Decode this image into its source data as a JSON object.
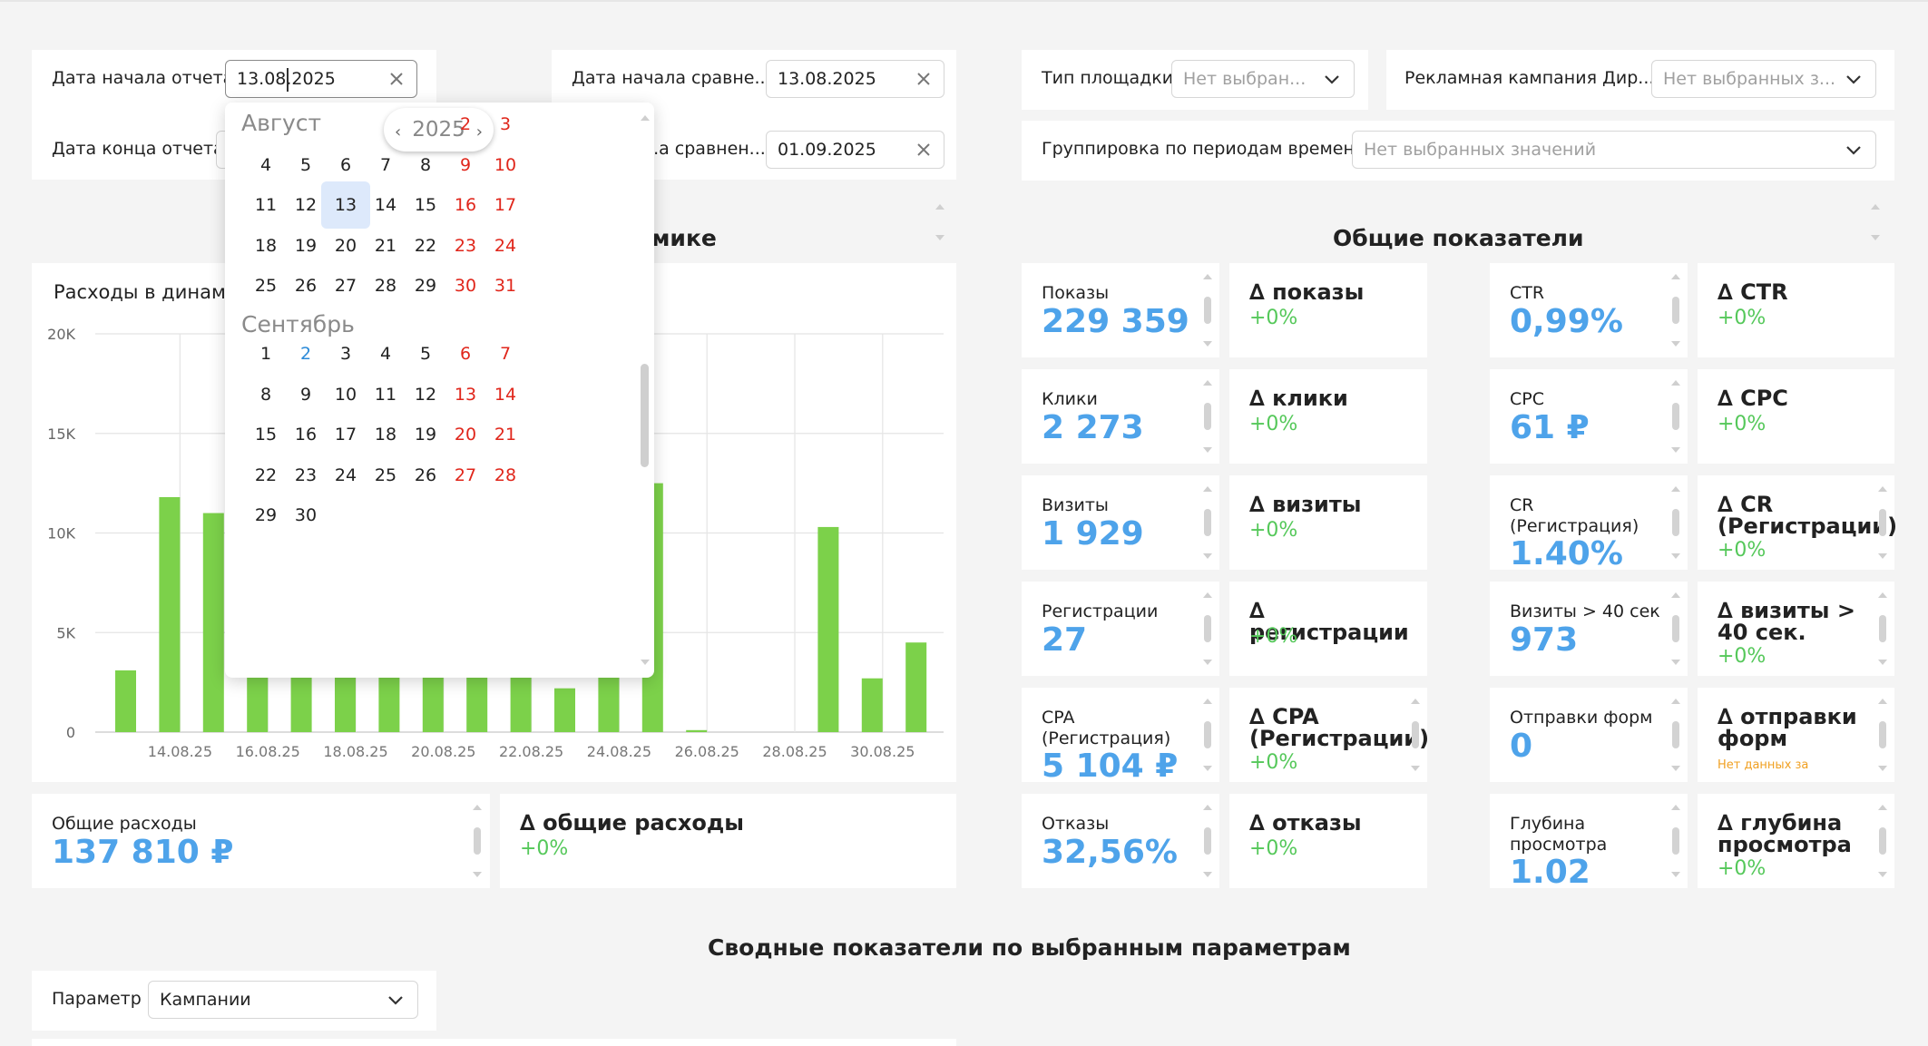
{
  "filters": {
    "report_start_label": "Дата начала отчета",
    "report_start_value": "13.08.2025",
    "report_end_label": "Дата конца отчета",
    "compare_start_label": "Дата начала сравне...",
    "compare_start_value": "13.08.2025",
    "compare_end_label": "...а сравнен...",
    "compare_end_value": "01.09.2025",
    "platform_label": "Тип площадки",
    "platform_placeholder": "Нет выбран...",
    "campaign_label": "Рекламная кампания Дир...",
    "campaign_placeholder": "Нет выбранных з...",
    "grouping_label": "Группировка по периодам времени",
    "grouping_placeholder": "Нет выбранных значений"
  },
  "calendar": {
    "year": "2025",
    "months": [
      {
        "name": "Август",
        "rows": [
          [
            {
              "d": "2",
              "we": true
            },
            {
              "d": "3",
              "we": true
            }
          ],
          [
            {
              "d": "4"
            },
            {
              "d": "5"
            },
            {
              "d": "6"
            },
            {
              "d": "7"
            },
            {
              "d": "8"
            },
            {
              "d": "9",
              "we": true
            },
            {
              "d": "10",
              "we": true
            }
          ],
          [
            {
              "d": "11"
            },
            {
              "d": "12"
            },
            {
              "d": "13",
              "sel": true
            },
            {
              "d": "14"
            },
            {
              "d": "15"
            },
            {
              "d": "16",
              "we": true
            },
            {
              "d": "17",
              "we": true
            }
          ],
          [
            {
              "d": "18"
            },
            {
              "d": "19"
            },
            {
              "d": "20"
            },
            {
              "d": "21"
            },
            {
              "d": "22"
            },
            {
              "d": "23",
              "we": true
            },
            {
              "d": "24",
              "we": true
            }
          ],
          [
            {
              "d": "25"
            },
            {
              "d": "26"
            },
            {
              "d": "27"
            },
            {
              "d": "28"
            },
            {
              "d": "29"
            },
            {
              "d": "30",
              "we": true
            },
            {
              "d": "31",
              "we": true
            }
          ]
        ]
      },
      {
        "name": "Сентябрь",
        "rows": [
          [
            {
              "d": "1"
            },
            {
              "d": "2",
              "today": true
            },
            {
              "d": "3"
            },
            {
              "d": "4"
            },
            {
              "d": "5"
            },
            {
              "d": "6",
              "we": true
            },
            {
              "d": "7",
              "we": true
            }
          ],
          [
            {
              "d": "8"
            },
            {
              "d": "9"
            },
            {
              "d": "10"
            },
            {
              "d": "11"
            },
            {
              "d": "12"
            },
            {
              "d": "13",
              "we": true
            },
            {
              "d": "14",
              "we": true
            }
          ],
          [
            {
              "d": "15"
            },
            {
              "d": "16"
            },
            {
              "d": "17"
            },
            {
              "d": "18"
            },
            {
              "d": "19"
            },
            {
              "d": "20",
              "we": true
            },
            {
              "d": "21",
              "we": true
            }
          ],
          [
            {
              "d": "22"
            },
            {
              "d": "23"
            },
            {
              "d": "24"
            },
            {
              "d": "25"
            },
            {
              "d": "26"
            },
            {
              "d": "27",
              "we": true
            },
            {
              "d": "28",
              "we": true
            }
          ],
          [
            {
              "d": "29"
            },
            {
              "d": "30"
            }
          ]
        ]
      }
    ]
  },
  "dynamics": {
    "section_title_fragment": "мике",
    "chart_title_fragment": "Расходы в динами"
  },
  "chart_data": {
    "type": "bar",
    "x": [
      "13.08.25",
      "14.08.25",
      "15.08.25",
      "16.08.25",
      "17.08.25",
      "18.08.25",
      "19.08.25",
      "20.08.25",
      "21.08.25",
      "22.08.25",
      "23.08.25",
      "24.08.25",
      "25.08.25",
      "26.08.25",
      "27.08.25",
      "28.08.25",
      "29.08.25",
      "30.08.25",
      "31.08.25",
      "01.09.25"
    ],
    "values": [
      3100,
      11800,
      11000,
      null,
      null,
      null,
      null,
      null,
      null,
      null,
      2200,
      null,
      12500,
      100,
      0,
      0,
      10300,
      2700,
      4500,
      null
    ],
    "xticks": [
      "14.08.25",
      "16.08.25",
      "18.08.25",
      "20.08.25",
      "22.08.25",
      "24.08.25",
      "26.08.25",
      "28.08.25",
      "30.08.25"
    ],
    "yticks": [
      "0",
      "5K",
      "10K",
      "15K",
      "20K"
    ],
    "ylim": [
      0,
      20000
    ],
    "color": "#7cd14a"
  },
  "totals": {
    "spend_label": "Общие расходы",
    "spend_value": "137 810 ₽",
    "delta_spend_label": "∆ общие расходы",
    "delta_spend_value": "+0%"
  },
  "overall": {
    "title": "Общие показатели",
    "impressions_label": "Показы",
    "impressions_value": "229 359",
    "d_impressions_label": "∆ показы",
    "d_impressions_value": "+0%",
    "ctr_label": "CTR",
    "ctr_value": "0,99%",
    "d_ctr_label": "∆ CTR",
    "d_ctr_value": "+0%",
    "clicks_label": "Клики",
    "clicks_value": "2 273",
    "d_clicks_label": "∆ клики",
    "d_clicks_value": "+0%",
    "cpc_label": "CPC",
    "cpc_value": "61 ₽",
    "d_cpc_label": "∆ CPC",
    "d_cpc_value": "+0%",
    "visits_label": "Визиты",
    "visits_value": "1 929",
    "d_visits_label": "∆ визиты",
    "d_visits_value": "+0%",
    "cr_label": "CR\n(Регистрация)",
    "cr_value": "1.40%",
    "d_cr_label": "∆ CR\n(Регистрации)",
    "d_cr_value": "+0%",
    "reg_label": "Регистрации",
    "reg_value": "27",
    "d_reg_label": "∆ регистрации",
    "d_reg_value": "+0%",
    "visits40_label": "Визиты > 40 сек",
    "visits40_value": "973",
    "d_visits40_label": "∆ визиты >\n40 сек.",
    "d_visits40_value": "+0%",
    "cpa_label": "CPA\n(Регистрация)",
    "cpa_value": "5 104 ₽",
    "d_cpa_label": "∆ CPA\n(Регистрации)",
    "d_cpa_value": "+0%",
    "forms_label": "Отправки форм",
    "forms_value": "0",
    "d_forms_label": "∆ отправки\nформ",
    "d_forms_note": "Нет данных за",
    "bounce_label": "Отказы",
    "bounce_value": "32,56%",
    "d_bounce_label": "∆ отказы",
    "d_bounce_value": "+0%",
    "depth_label": "Глубина\nпросмотра",
    "depth_value": "1.02",
    "d_depth_label": "∆ глубина\nпросмотра",
    "d_depth_value": "+0%"
  },
  "summary": {
    "title": "Сводные показатели по выбранным параметрам",
    "param_label": "Параметр",
    "param_value": "Кампании"
  }
}
